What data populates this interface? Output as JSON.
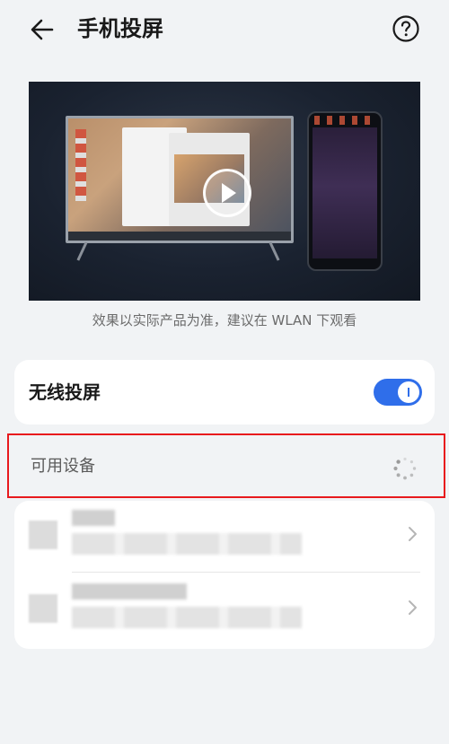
{
  "header": {
    "title": "手机投屏",
    "back_icon": "arrow-left-icon",
    "help_icon": "question-circle-icon"
  },
  "preview": {
    "caption": "效果以实际产品为准，建议在 WLAN 下观看",
    "play_icon": "play-icon"
  },
  "wireless": {
    "label": "无线投屏",
    "enabled": true,
    "accent": "#2f6eea"
  },
  "available": {
    "label": "可用设备",
    "highlight_color": "#e8191d",
    "loading_icon": "loading-spinner-icon"
  },
  "devices": [
    {
      "name": "",
      "blurred": true,
      "chevron_icon": "chevron-right-icon"
    },
    {
      "name": "",
      "blurred": true,
      "chevron_icon": "chevron-right-icon"
    }
  ]
}
